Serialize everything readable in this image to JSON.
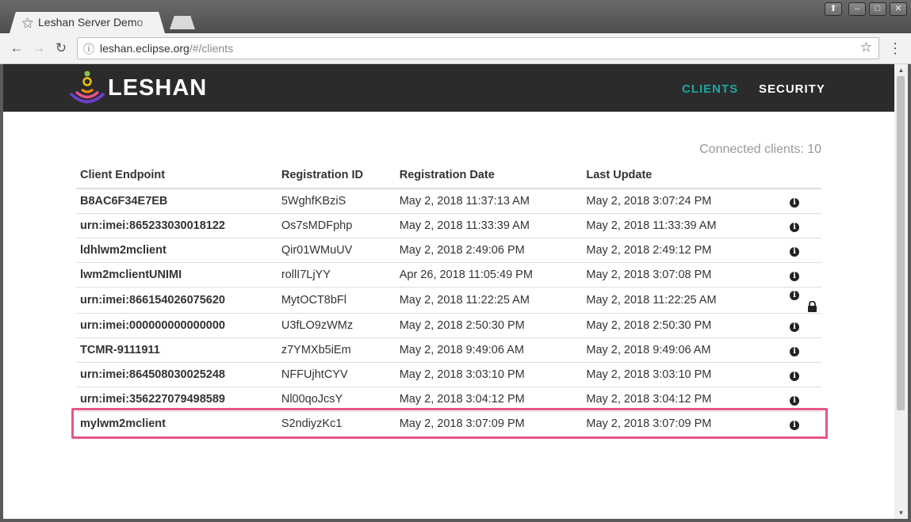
{
  "browser": {
    "tab_title": "Leshan Server Demo",
    "url_host": "leshan.eclipse.org",
    "url_path": "/#/clients",
    "window_buttons": [
      "⬆",
      "–",
      "□",
      "✕"
    ]
  },
  "header": {
    "logo_text": "LESHAN",
    "nav": [
      {
        "label": "CLIENTS",
        "active": true
      },
      {
        "label": "SECURITY",
        "active": false
      }
    ],
    "accent_color": "#1da6a0"
  },
  "main": {
    "connected_text": "Connected clients: 10",
    "columns": [
      "Client Endpoint",
      "Registration ID",
      "Registration Date",
      "Last Update"
    ],
    "rows": [
      {
        "endpoint": "B8AC6F34E7EB",
        "reg_id": "5WghfKBziS",
        "reg_date": "May 2, 2018 11:37:13 AM",
        "last_update": "May 2, 2018 3:07:24 PM",
        "secure": false
      },
      {
        "endpoint": "urn:imei:865233030018122",
        "reg_id": "Os7sMDFphp",
        "reg_date": "May 2, 2018 11:33:39 AM",
        "last_update": "May 2, 2018 11:33:39 AM",
        "secure": false
      },
      {
        "endpoint": "ldhlwm2mclient",
        "reg_id": "Qir01WMuUV",
        "reg_date": "May 2, 2018 2:49:06 PM",
        "last_update": "May 2, 2018 2:49:12 PM",
        "secure": false
      },
      {
        "endpoint": "lwm2mclientUNIMI",
        "reg_id": "rollI7LjYY",
        "reg_date": "Apr 26, 2018 11:05:49 PM",
        "last_update": "May 2, 2018 3:07:08 PM",
        "secure": false
      },
      {
        "endpoint": "urn:imei:866154026075620",
        "reg_id": "MytOCT8bFl",
        "reg_date": "May 2, 2018 11:22:25 AM",
        "last_update": "May 2, 2018 11:22:25 AM",
        "secure": true
      },
      {
        "endpoint": "urn:imei:000000000000000",
        "reg_id": "U3fLO9zWMz",
        "reg_date": "May 2, 2018 2:50:30 PM",
        "last_update": "May 2, 2018 2:50:30 PM",
        "secure": false
      },
      {
        "endpoint": "TCMR-9111911",
        "reg_id": "z7YMXb5iEm",
        "reg_date": "May 2, 2018 9:49:06 AM",
        "last_update": "May 2, 2018 9:49:06 AM",
        "secure": false
      },
      {
        "endpoint": "urn:imei:864508030025248",
        "reg_id": "NFFUjhtCYV",
        "reg_date": "May 2, 2018 3:03:10 PM",
        "last_update": "May 2, 2018 3:03:10 PM",
        "secure": false
      },
      {
        "endpoint": "urn:imei:356227079498589",
        "reg_id": "Nl00qoJcsY",
        "reg_date": "May 2, 2018 3:04:12 PM",
        "last_update": "May 2, 2018 3:04:12 PM",
        "secure": false
      },
      {
        "endpoint": "mylwm2mclient",
        "reg_id": "S2ndiyzKc1",
        "reg_date": "May 2, 2018 3:07:09 PM",
        "last_update": "May 2, 2018 3:07:09 PM",
        "secure": false
      }
    ],
    "highlight_color": "#e8548a"
  }
}
